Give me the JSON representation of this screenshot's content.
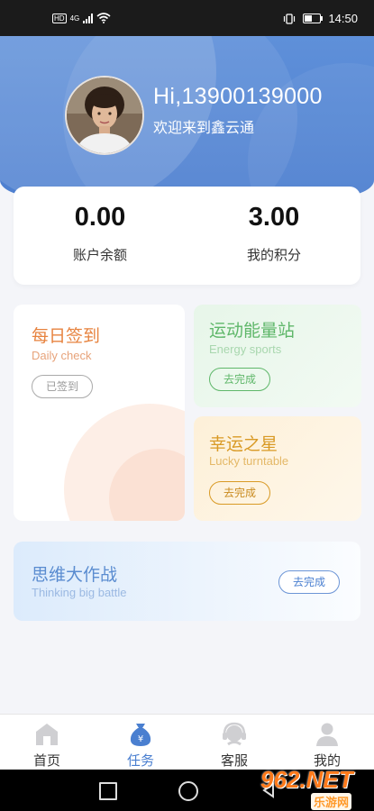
{
  "status_bar": {
    "hd": "HD",
    "network": "4G",
    "time": "14:50",
    "battery_level": 0.45
  },
  "header": {
    "greeting": "Hi,13900139000",
    "welcome": "欢迎来到鑫云通"
  },
  "balance": {
    "account_balance_value": "0.00",
    "account_balance_label": "账户余额",
    "points_value": "3.00",
    "points_label": "我的积分"
  },
  "tasks": {
    "daily_check": {
      "title": "每日签到",
      "subtitle": "Daily check",
      "button": "已签到"
    },
    "energy_sports": {
      "title": "运动能量站",
      "subtitle": "Energy sports",
      "button": "去完成"
    },
    "lucky_turntable": {
      "title": "幸运之星",
      "subtitle": "Lucky turntable",
      "button": "去完成"
    },
    "thinking_battle": {
      "title": "思维大作战",
      "subtitle": "Thinking big battle",
      "button": "去完成"
    }
  },
  "tabbar": {
    "items": [
      {
        "label": "首页",
        "icon": "home-icon"
      },
      {
        "label": "任务",
        "icon": "money-bag-icon"
      },
      {
        "label": "客服",
        "icon": "customer-service-icon"
      },
      {
        "label": "我的",
        "icon": "profile-icon"
      }
    ],
    "active_index": 1
  },
  "watermark": {
    "main": "962.NET",
    "sub": "乐游网"
  },
  "colors": {
    "header_blue": "#5f90d9",
    "active_tab": "#4a7fd0",
    "daily_orange": "#e7833f",
    "energy_green": "#5fb76a",
    "lucky_gold": "#d99a25",
    "thinking_blue": "#5a8cd0"
  }
}
